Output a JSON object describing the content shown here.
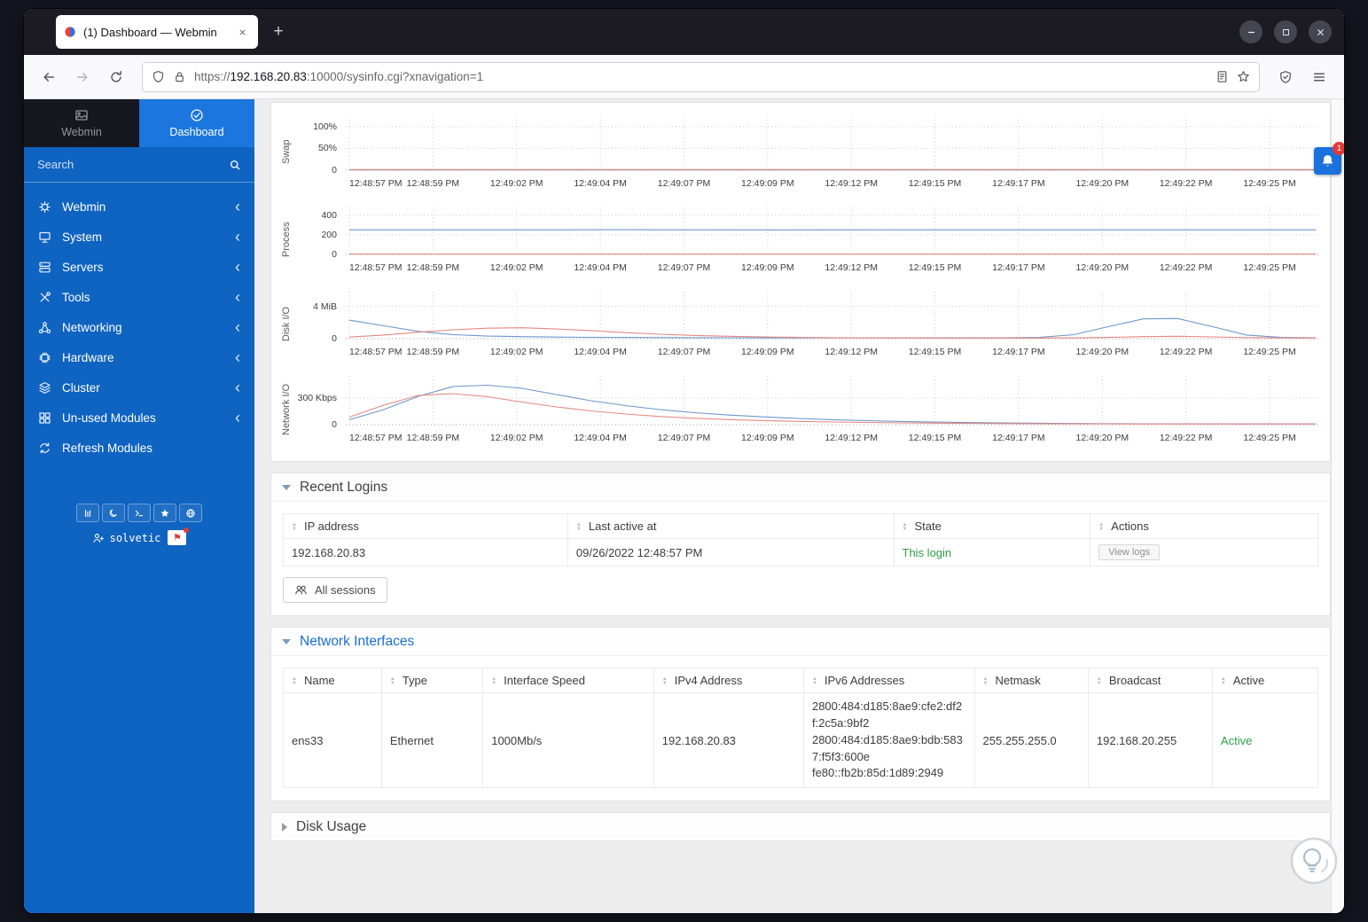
{
  "browser": {
    "tab_title": "(1) Dashboard — Webmin",
    "new_tab": "+",
    "url_scheme": "https://",
    "url_host": "192.168.20.83",
    "url_rest": ":10000/sysinfo.cgi?xnavigation=1"
  },
  "sidebar": {
    "webmin_label": "Webmin",
    "dashboard_label": "Dashboard",
    "search_placeholder": "Search",
    "items": [
      {
        "label": "Webmin",
        "icon": "gear-icon",
        "chevron": true
      },
      {
        "label": "System",
        "icon": "monitor-icon",
        "chevron": true
      },
      {
        "label": "Servers",
        "icon": "server-icon",
        "chevron": true
      },
      {
        "label": "Tools",
        "icon": "tools-icon",
        "chevron": true
      },
      {
        "label": "Networking",
        "icon": "network-icon",
        "chevron": true
      },
      {
        "label": "Hardware",
        "icon": "chip-icon",
        "chevron": true
      },
      {
        "label": "Cluster",
        "icon": "layers-icon",
        "chevron": true
      },
      {
        "label": "Un-used Modules",
        "icon": "modules-icon",
        "chevron": true
      },
      {
        "label": "Refresh Modules",
        "icon": "refresh-icon",
        "chevron": false
      }
    ],
    "footer_buttons": [
      "stats-icon",
      "moon-icon",
      "terminal-icon",
      "star-icon",
      "globe-icon"
    ],
    "user": "solvetic"
  },
  "notification": {
    "count": "1"
  },
  "colors": {
    "accent": "#1b74d9",
    "sidebar": "#0f63c1",
    "green": "#2e9e43",
    "badge_red": "#e53935",
    "line_blue": "#6b97cd",
    "line_red": "#e58880"
  },
  "chart_data": {
    "type": "line",
    "x_labels": [
      "12:48:57 PM",
      "12:48:59 PM",
      "12:49:02 PM",
      "12:49:04 PM",
      "12:49:07 PM",
      "12:49:09 PM",
      "12:49:12 PM",
      "12:49:15 PM",
      "12:49:17 PM",
      "12:49:20 PM",
      "12:49:22 PM",
      "12:49:25 PM"
    ],
    "charts": [
      {
        "name": "Swap",
        "ymax": 118,
        "yticks": [
          {
            "v": 100,
            "label": "100%"
          },
          {
            "v": 50,
            "label": "50%"
          },
          {
            "v": 0,
            "label": "0"
          }
        ],
        "series": [
          {
            "name": "swap-blue",
            "color": "#6b97cd",
            "values": [
              0.6,
              0.6
            ]
          },
          {
            "name": "swap-red",
            "color": "#e58880",
            "values": [
              1.4,
              1.4
            ]
          }
        ]
      },
      {
        "name": "Process",
        "ymax": 450,
        "yticks": [
          {
            "v": 400,
            "label": "400"
          },
          {
            "v": 200,
            "label": "200"
          },
          {
            "v": 0,
            "label": "0"
          }
        ],
        "series": [
          {
            "name": "process-count",
            "color": "#6b97cd",
            "values": [
              250,
              250,
              251,
              249,
              250,
              250,
              250,
              250
            ]
          },
          {
            "name": "process-red",
            "color": "#e58880",
            "values": [
              4,
              4
            ]
          }
        ]
      },
      {
        "name": "Disk I/O",
        "ymax": 5.5,
        "yticks": [
          {
            "v": 4,
            "label": "4 MiB"
          },
          {
            "v": 0,
            "label": "0"
          }
        ],
        "series": [
          {
            "name": "disk-read",
            "color": "#6b97cd",
            "values": [
              2.3,
              1.6,
              0.9,
              0.5,
              0.32,
              0.25,
              0.2,
              0.17,
              0.15,
              0.13,
              0.12,
              0.11,
              0.1,
              0.1,
              0.1,
              0.1,
              0.1,
              0.1,
              0.1,
              0.1,
              0.15,
              0.5,
              1.5,
              2.45,
              2.5,
              1.5,
              0.45,
              0.15,
              0.1
            ]
          },
          {
            "name": "disk-write",
            "color": "#e58880",
            "values": [
              0.2,
              0.45,
              0.8,
              1.1,
              1.3,
              1.35,
              1.2,
              1.0,
              0.75,
              0.55,
              0.4,
              0.3,
              0.22,
              0.16,
              0.12,
              0.1,
              0.09,
              0.08,
              0.08,
              0.08,
              0.08,
              0.1,
              0.15,
              0.25,
              0.3,
              0.22,
              0.13,
              0.09,
              0.08
            ]
          }
        ]
      },
      {
        "name": "Network I/O",
        "ymax": 520,
        "yticks": [
          {
            "v": 300,
            "label": "300 Kbps"
          },
          {
            "v": 0,
            "label": "0"
          }
        ],
        "series": [
          {
            "name": "net-in",
            "color": "#6b97cd",
            "values": [
              55,
              170,
              320,
              430,
              445,
              410,
              340,
              270,
              215,
              170,
              135,
              108,
              88,
              70,
              56,
              45,
              36,
              29,
              23,
              19,
              16,
              13,
              11,
              10,
              9,
              9,
              8,
              8,
              8
            ]
          },
          {
            "name": "net-out",
            "color": "#e58880",
            "values": [
              85,
              220,
              330,
              350,
              315,
              255,
              200,
              155,
              120,
              92,
              72,
              57,
              46,
              37,
              30,
              25,
              20,
              17,
              14,
              12,
              10,
              9,
              9,
              8,
              8,
              8,
              8,
              8,
              8
            ]
          }
        ]
      }
    ]
  },
  "recent_logins": {
    "title": "Recent Logins",
    "columns": [
      "IP address",
      "Last active at",
      "State",
      "Actions"
    ],
    "rows": [
      {
        "ip": "192.168.20.83",
        "last_active": "09/26/2022 12:48:57 PM",
        "state": "This login",
        "action": "View logs"
      }
    ],
    "all_sessions_label": "All sessions"
  },
  "network_interfaces": {
    "title": "Network Interfaces",
    "columns": [
      "Name",
      "Type",
      "Interface Speed",
      "IPv4 Address",
      "IPv6 Addresses",
      "Netmask",
      "Broadcast",
      "Active"
    ],
    "rows": [
      {
        "name": "ens33",
        "type": "Ethernet",
        "speed": "1000Mb/s",
        "ipv4": "192.168.20.83",
        "ipv6": [
          "2800:484:d185:8ae9:cfe2:df2f:2c5a:9bf2",
          "2800:484:d185:8ae9:bdb:5837:f5f3:600e",
          "fe80::fb2b:85d:1d89:2949"
        ],
        "netmask": "255.255.255.0",
        "broadcast": "192.168.20.255",
        "active": "Active"
      }
    ]
  },
  "disk_usage": {
    "title": "Disk Usage"
  }
}
